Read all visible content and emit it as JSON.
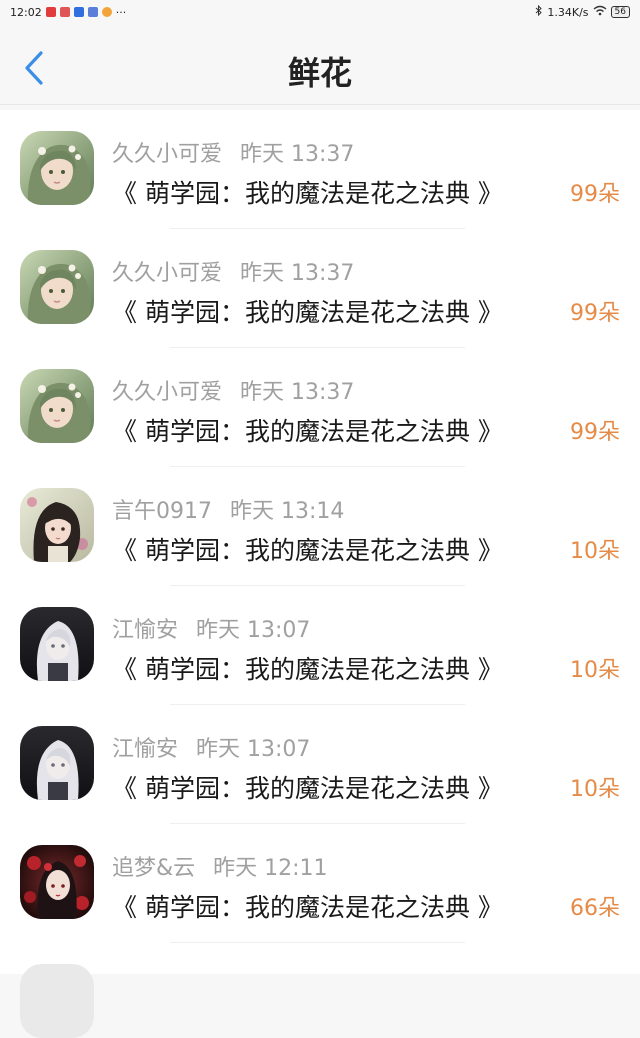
{
  "status_bar": {
    "time": "12:02",
    "dots": "···",
    "network_speed": "1.34K/s",
    "battery": "56"
  },
  "header": {
    "title": "鲜花"
  },
  "colors": {
    "accent_blue": "#3a8ee6",
    "count_orange": "#e58b47",
    "meta_gray": "#a0a0a0"
  },
  "rows": [
    {
      "user": "久久小可爱",
      "time": "昨天 13:37",
      "book": "《 萌学园：我的魔法是花之法典 》",
      "count": "99朵",
      "avatar": "green-haired-girl"
    },
    {
      "user": "久久小可爱",
      "time": "昨天 13:37",
      "book": "《 萌学园：我的魔法是花之法典 》",
      "count": "99朵",
      "avatar": "green-haired-girl"
    },
    {
      "user": "久久小可爱",
      "time": "昨天 13:37",
      "book": "《 萌学园：我的魔法是花之法典 》",
      "count": "99朵",
      "avatar": "green-haired-girl"
    },
    {
      "user": "言午0917",
      "time": "昨天 13:14",
      "book": "《 萌学园：我的魔法是花之法典 》",
      "count": "10朵",
      "avatar": "dark-haired-girl"
    },
    {
      "user": "江愉安",
      "time": "昨天 13:07",
      "book": "《 萌学园：我的魔法是花之法典 》",
      "count": "10朵",
      "avatar": "white-haired-girl"
    },
    {
      "user": "江愉安",
      "time": "昨天 13:07",
      "book": "《 萌学园：我的魔法是花之法典 》",
      "count": "10朵",
      "avatar": "white-haired-girl"
    },
    {
      "user": "追梦&云",
      "time": "昨天 12:11",
      "book": "《 萌学园：我的魔法是花之法典 》",
      "count": "66朵",
      "avatar": "red-flower-girl"
    }
  ]
}
